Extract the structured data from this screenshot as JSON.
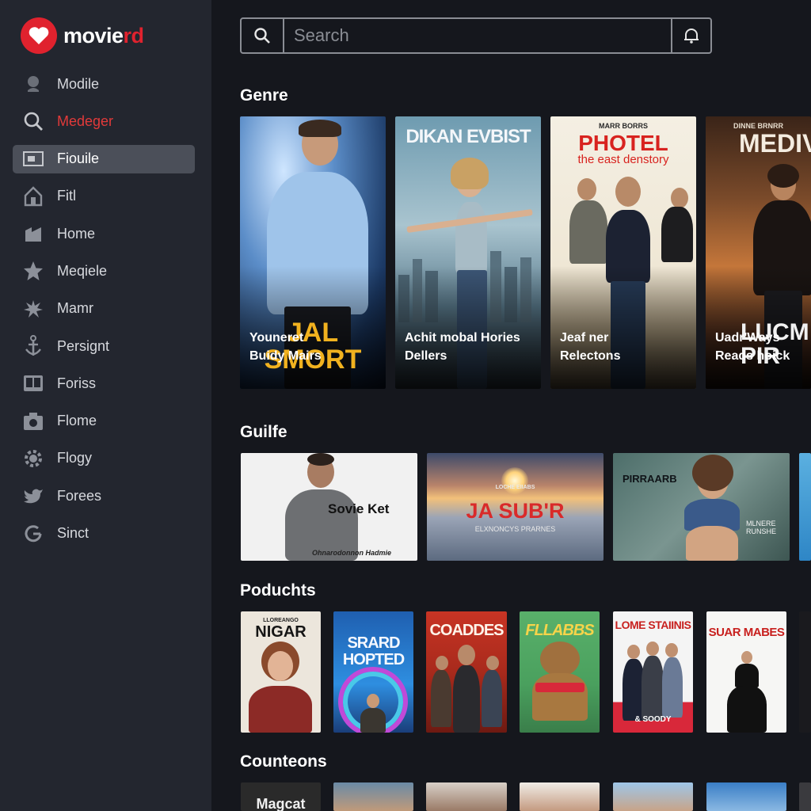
{
  "app": {
    "logo_text_main": "movie",
    "logo_text_accent": "rd",
    "accent_color": "#e0222e"
  },
  "sidebar": {
    "items": [
      {
        "label": "Modile",
        "icon": "user-icon"
      },
      {
        "label": "Medeger",
        "icon": "search-icon"
      },
      {
        "label": "Fiouile",
        "icon": "monitor-icon"
      },
      {
        "label": "Fitl",
        "icon": "home-icon"
      },
      {
        "label": "Home",
        "icon": "film-icon"
      },
      {
        "label": "Meqiele",
        "icon": "star-icon"
      },
      {
        "label": "Mamr",
        "icon": "burst-icon"
      },
      {
        "label": "Persignt",
        "icon": "anchor-icon"
      },
      {
        "label": "Foriss",
        "icon": "book-icon"
      },
      {
        "label": "Flome",
        "icon": "camera-icon"
      },
      {
        "label": "Flogy",
        "icon": "gear-icon"
      },
      {
        "label": "Forees",
        "icon": "bird-icon"
      },
      {
        "label": "Sinct",
        "icon": "refresh-icon"
      }
    ]
  },
  "search": {
    "placeholder": "Search"
  },
  "sections": {
    "genre": {
      "title": "Genre",
      "cards": [
        {
          "poster_title": "JAL SMORT",
          "caption_1": "Youneret",
          "caption_2": "Buidy Mairs"
        },
        {
          "poster_title": "DIKAN EVBIST",
          "caption_1": "Achit mobal Hories",
          "caption_2": "Dellers"
        },
        {
          "poster_title": "PHOTEL",
          "poster_sub": "the east denstory",
          "poster_top": "MARR BORRS",
          "caption_1": "Jeaf ner",
          "caption_2": "Relectons"
        },
        {
          "poster_title": "MEDIV",
          "poster_top": "DINNE BRNRR",
          "poster_bottom": "LUCM PIR",
          "caption_1": "Uadr'Ways",
          "caption_2": "Reads hoick"
        }
      ]
    },
    "guilfe": {
      "title": "Guilfe",
      "cards": [
        {
          "poster_title": "Sovie Ket",
          "poster_footer": "Ohnarodonnon Hadmie"
        },
        {
          "poster_title": "JA SUB'R",
          "poster_top": "LOCHE EIIABS",
          "poster_sub": "ELXNONCYS PRARNES"
        },
        {
          "poster_title": "PIRRAARB",
          "poster_sub": "MLNERE RUNSHE"
        }
      ]
    },
    "poduchts": {
      "title": "Poduchts",
      "cards": [
        {
          "poster_title": "NIGAR",
          "poster_top": "LLOREANGO"
        },
        {
          "poster_title": "SRARD HOPTED"
        },
        {
          "poster_title": "COADDES"
        },
        {
          "poster_title": "FLLABBS"
        },
        {
          "poster_title": "LOME STAIINIS",
          "poster_footer": "& SOODY"
        },
        {
          "poster_title": "SUAR MABES"
        }
      ]
    },
    "counteons": {
      "title": "Counteons",
      "cards": [
        {
          "poster_title": "Magcat"
        }
      ]
    }
  }
}
